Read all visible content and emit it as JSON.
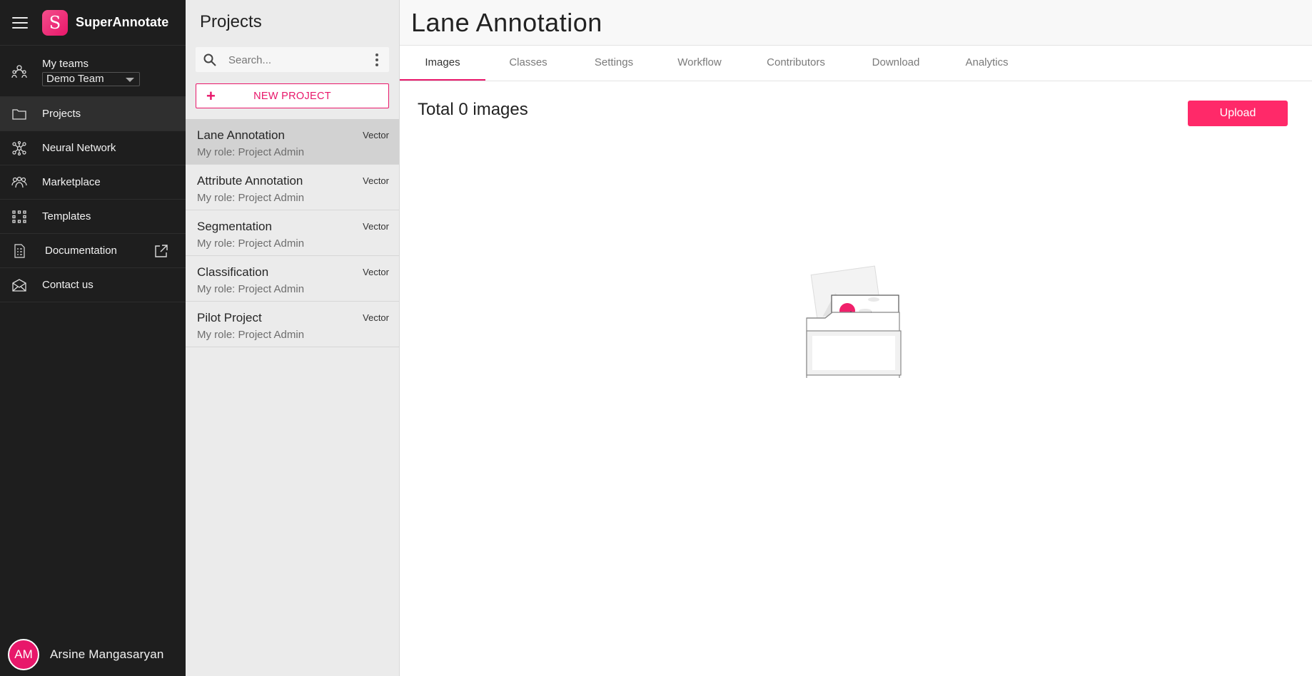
{
  "brand": {
    "name": "SuperAnnotate",
    "logo_letter": "S",
    "accent_color": "#e8176a"
  },
  "nav": {
    "teams_label": "My teams",
    "team_selected": "Demo Team",
    "items": [
      {
        "label": "Projects",
        "icon": "folder-icon",
        "active": true
      },
      {
        "label": "Neural Network",
        "icon": "neural-network-icon"
      },
      {
        "label": "Marketplace",
        "icon": "marketplace-icon"
      },
      {
        "label": "Templates",
        "icon": "templates-icon"
      },
      {
        "label": "Documentation",
        "icon": "documentation-icon",
        "external": true
      },
      {
        "label": "Contact us",
        "icon": "mail-icon"
      }
    ],
    "user": {
      "initials": "AM",
      "name": "Arsine Mangasaryan"
    }
  },
  "projects": {
    "title": "Projects",
    "search_placeholder": "Search...",
    "new_project_label": "NEW PROJECT",
    "list": [
      {
        "name": "Lane Annotation",
        "role": "My role: Project Admin",
        "type": "Vector",
        "active": true
      },
      {
        "name": "Attribute Annotation",
        "role": "My role: Project Admin",
        "type": "Vector"
      },
      {
        "name": "Segmentation",
        "role": "My role: Project Admin",
        "type": "Vector"
      },
      {
        "name": "Classification",
        "role": "My role: Project Admin",
        "type": "Vector"
      },
      {
        "name": "Pilot Project",
        "role": "My role: Project Admin",
        "type": "Vector"
      }
    ]
  },
  "main": {
    "title": "Lane Annotation",
    "tabs": [
      {
        "label": "Images",
        "active": true
      },
      {
        "label": "Classes"
      },
      {
        "label": "Settings"
      },
      {
        "label": "Workflow"
      },
      {
        "label": "Contributors"
      },
      {
        "label": "Download"
      },
      {
        "label": "Analytics"
      }
    ],
    "total_text": "Total 0 images",
    "upload_label": "Upload",
    "empty_state_icon": "empty-folder-illustration"
  }
}
